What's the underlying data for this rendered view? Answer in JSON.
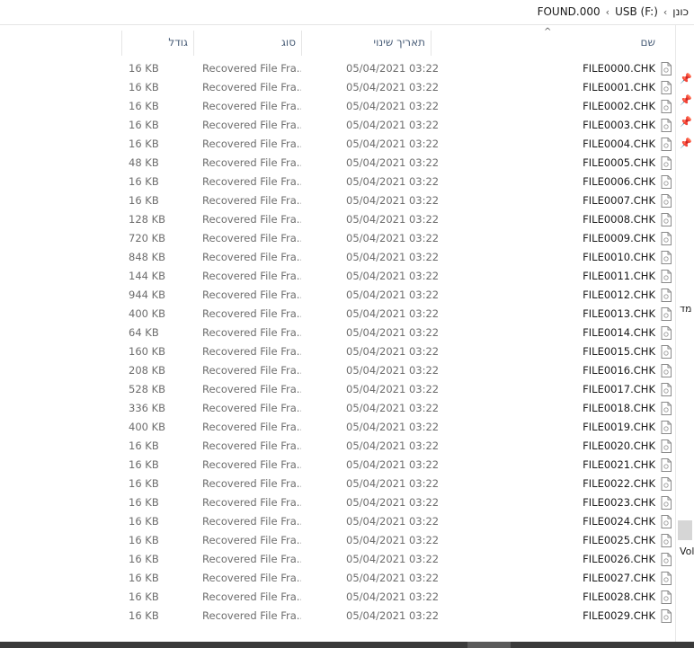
{
  "breadcrumb": [
    "כונן",
    "USB (F:)",
    "FOUND.000"
  ],
  "columns": {
    "name": "שם",
    "date": "תאריך שינוי",
    "type": "סוג",
    "size": "גודל"
  },
  "nav": {
    "label1": "מד",
    "label2": "Volu"
  },
  "files": [
    {
      "name": "FILE0000.CHK",
      "date": "05/04/2021 03:22",
      "type": "Recovered File Fra...",
      "size": "16 KB"
    },
    {
      "name": "FILE0001.CHK",
      "date": "05/04/2021 03:22",
      "type": "Recovered File Fra...",
      "size": "16 KB"
    },
    {
      "name": "FILE0002.CHK",
      "date": "05/04/2021 03:22",
      "type": "Recovered File Fra...",
      "size": "16 KB"
    },
    {
      "name": "FILE0003.CHK",
      "date": "05/04/2021 03:22",
      "type": "Recovered File Fra...",
      "size": "16 KB"
    },
    {
      "name": "FILE0004.CHK",
      "date": "05/04/2021 03:22",
      "type": "Recovered File Fra...",
      "size": "16 KB"
    },
    {
      "name": "FILE0005.CHK",
      "date": "05/04/2021 03:22",
      "type": "Recovered File Fra...",
      "size": "48 KB"
    },
    {
      "name": "FILE0006.CHK",
      "date": "05/04/2021 03:22",
      "type": "Recovered File Fra...",
      "size": "16 KB"
    },
    {
      "name": "FILE0007.CHK",
      "date": "05/04/2021 03:22",
      "type": "Recovered File Fra...",
      "size": "16 KB"
    },
    {
      "name": "FILE0008.CHK",
      "date": "05/04/2021 03:22",
      "type": "Recovered File Fra...",
      "size": "128 KB"
    },
    {
      "name": "FILE0009.CHK",
      "date": "05/04/2021 03:22",
      "type": "Recovered File Fra...",
      "size": "720 KB"
    },
    {
      "name": "FILE0010.CHK",
      "date": "05/04/2021 03:22",
      "type": "Recovered File Fra...",
      "size": "848 KB"
    },
    {
      "name": "FILE0011.CHK",
      "date": "05/04/2021 03:22",
      "type": "Recovered File Fra...",
      "size": "144 KB"
    },
    {
      "name": "FILE0012.CHK",
      "date": "05/04/2021 03:22",
      "type": "Recovered File Fra...",
      "size": "944 KB"
    },
    {
      "name": "FILE0013.CHK",
      "date": "05/04/2021 03:22",
      "type": "Recovered File Fra...",
      "size": "400 KB"
    },
    {
      "name": "FILE0014.CHK",
      "date": "05/04/2021 03:22",
      "type": "Recovered File Fra...",
      "size": "64 KB"
    },
    {
      "name": "FILE0015.CHK",
      "date": "05/04/2021 03:22",
      "type": "Recovered File Fra...",
      "size": "160 KB"
    },
    {
      "name": "FILE0016.CHK",
      "date": "05/04/2021 03:22",
      "type": "Recovered File Fra...",
      "size": "208 KB"
    },
    {
      "name": "FILE0017.CHK",
      "date": "05/04/2021 03:22",
      "type": "Recovered File Fra...",
      "size": "528 KB"
    },
    {
      "name": "FILE0018.CHK",
      "date": "05/04/2021 03:22",
      "type": "Recovered File Fra...",
      "size": "336 KB"
    },
    {
      "name": "FILE0019.CHK",
      "date": "05/04/2021 03:22",
      "type": "Recovered File Fra...",
      "size": "400 KB"
    },
    {
      "name": "FILE0020.CHK",
      "date": "05/04/2021 03:22",
      "type": "Recovered File Fra...",
      "size": "16 KB"
    },
    {
      "name": "FILE0021.CHK",
      "date": "05/04/2021 03:22",
      "type": "Recovered File Fra...",
      "size": "16 KB"
    },
    {
      "name": "FILE0022.CHK",
      "date": "05/04/2021 03:22",
      "type": "Recovered File Fra...",
      "size": "16 KB"
    },
    {
      "name": "FILE0023.CHK",
      "date": "05/04/2021 03:22",
      "type": "Recovered File Fra...",
      "size": "16 KB"
    },
    {
      "name": "FILE0024.CHK",
      "date": "05/04/2021 03:22",
      "type": "Recovered File Fra...",
      "size": "16 KB"
    },
    {
      "name": "FILE0025.CHK",
      "date": "05/04/2021 03:22",
      "type": "Recovered File Fra...",
      "size": "16 KB"
    },
    {
      "name": "FILE0026.CHK",
      "date": "05/04/2021 03:22",
      "type": "Recovered File Fra...",
      "size": "16 KB"
    },
    {
      "name": "FILE0027.CHK",
      "date": "05/04/2021 03:22",
      "type": "Recovered File Fra...",
      "size": "16 KB"
    },
    {
      "name": "FILE0028.CHK",
      "date": "05/04/2021 03:22",
      "type": "Recovered File Fra...",
      "size": "16 KB"
    },
    {
      "name": "FILE0029.CHK",
      "date": "05/04/2021 03:22",
      "type": "Recovered File Fra...",
      "size": "16 KB"
    }
  ]
}
